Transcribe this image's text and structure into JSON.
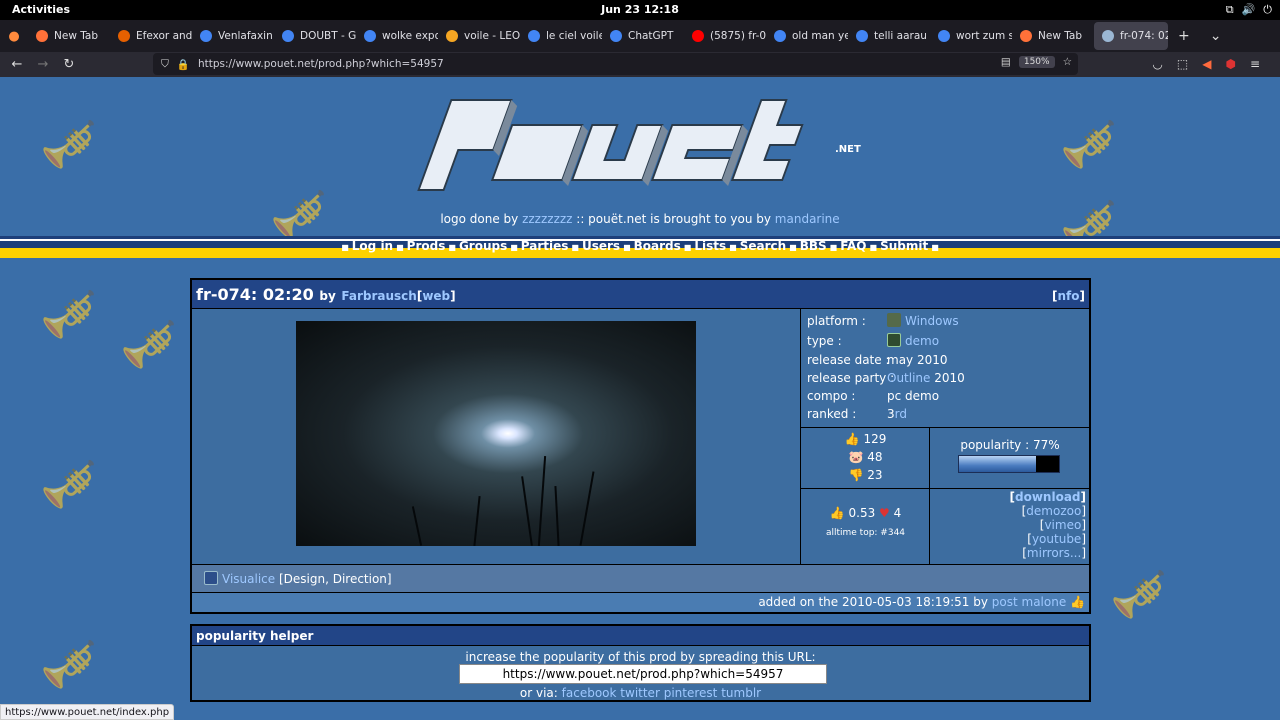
{
  "gnome": {
    "activities": "Activities",
    "clock": "Jun 23  12:18"
  },
  "tabs": [
    {
      "label": "New Tab",
      "color": "#ff7139"
    },
    {
      "label": "Efexor and D",
      "color": "#e66000"
    },
    {
      "label": "Venlafaxin h",
      "color": "#4285f4"
    },
    {
      "label": "DOUBT - Go",
      "color": "#4285f4"
    },
    {
      "label": "wolke expo",
      "color": "#4285f4"
    },
    {
      "label": "voile - LEO:",
      "color": "#f5a623"
    },
    {
      "label": "le ciel voile",
      "color": "#4285f4"
    },
    {
      "label": "ChatGPT",
      "color": "#4285f4"
    },
    {
      "label": "(5875) fr-03",
      "color": "#ff0000"
    },
    {
      "label": "old man yel",
      "color": "#4285f4"
    },
    {
      "label": "telli aarau p",
      "color": "#4285f4"
    },
    {
      "label": "wort zum sc",
      "color": "#4285f4"
    },
    {
      "label": "New Tab",
      "color": "#ff7139"
    },
    {
      "label": "fr-074: 02",
      "color": "#9bb7d4"
    }
  ],
  "nav": {
    "url": "https://www.pouet.net/prod.php?which=54957",
    "zoom": "150%"
  },
  "site": {
    "logo_text": "POUËT",
    "logo_suffix": ".NET",
    "credit_pre": "logo done by ",
    "credit_author": "zzzzzzzz",
    "credit_mid": " :: pouët.net is brought to you by ",
    "credit_sponsor": "mandarine",
    "menu": [
      "Log in",
      "Prods",
      "Groups",
      "Parties",
      "Users",
      "Boards",
      "Lists",
      "Search",
      "BBS",
      "FAQ",
      "Submit"
    ]
  },
  "prod": {
    "title": "fr-074: 02:20",
    "by": "by",
    "group": "Farbrausch",
    "web": "web",
    "nfo": "nfo",
    "info": {
      "platform_key": "platform :",
      "platform": "Windows",
      "type_key": "type :",
      "type": "demo",
      "release_date_key": "release date :",
      "release_date": "may 2010",
      "party_key": "release party :",
      "party": "Outline",
      "party_year": "2010",
      "compo_key": "compo :",
      "compo": "pc demo",
      "ranked_key": "ranked :",
      "ranked_num": "3",
      "ranked_suffix": "rd"
    },
    "votes": {
      "up": "129",
      "pig": "48",
      "down": "23"
    },
    "popularity_label": "popularity : 77%",
    "popularity_value": 0.77,
    "cdc": {
      "avg": "0.53",
      "cdc_count": "4",
      "alltime": "alltime top: #344"
    },
    "links": [
      "download",
      "demozoo",
      "vimeo",
      "youtube",
      "mirrors..."
    ],
    "credit_name": "Visualice",
    "credit_role": " [Design, Direction]",
    "added_pre": "added on the 2010-05-03 18:19:51 by ",
    "added_user": "post malone"
  },
  "helper": {
    "title": "popularity helper",
    "text": "increase the popularity of this prod by spreading this URL:",
    "url": "https://www.pouet.net/prod.php?which=54957",
    "via": "or via: ",
    "share": [
      "facebook",
      "twitter",
      "pinterest",
      "tumblr"
    ]
  },
  "status_bar": "https://www.pouet.net/index.php",
  "colors": {
    "page_bg": "#3a6ea8",
    "box_head": "#224587",
    "link": "#9ec8ff",
    "yellow_band": "#ffd200"
  }
}
